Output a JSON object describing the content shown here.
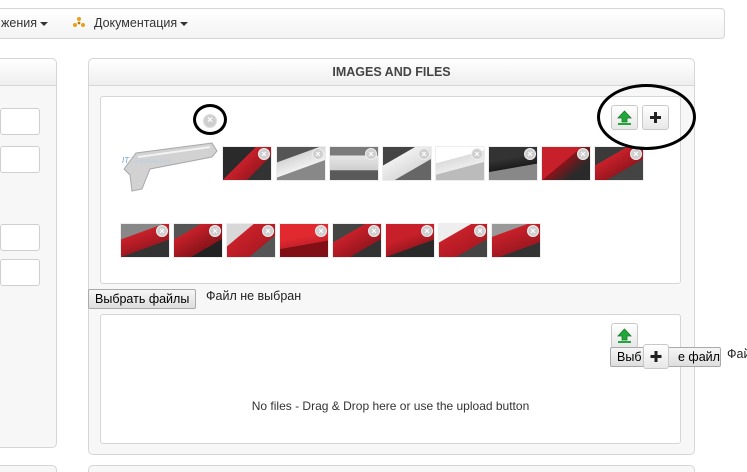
{
  "nav": {
    "item1": "жения",
    "item2": "Документация"
  },
  "panel": {
    "title": "IMAGES AND FILES"
  },
  "file_input": {
    "button_label": "Выбрать файлы",
    "status": "Файл не выбран"
  },
  "drop_zone": {
    "message": "No files - Drag & Drop here or use the upload button"
  },
  "overlay_file_input": {
    "button_left": "Выб",
    "button_right": "е файл",
    "trailing": "Фай"
  },
  "colors": {
    "upload_green": "#22a83a",
    "thumb_red": "#c8202a",
    "thumb_dark": "#2a2a2a",
    "thumb_white": "#e9e9e9"
  },
  "icons": {
    "upload": "upload-arrow-icon",
    "add": "plus-icon",
    "delete": "delete-circle-icon",
    "cog": "cog-icon"
  }
}
